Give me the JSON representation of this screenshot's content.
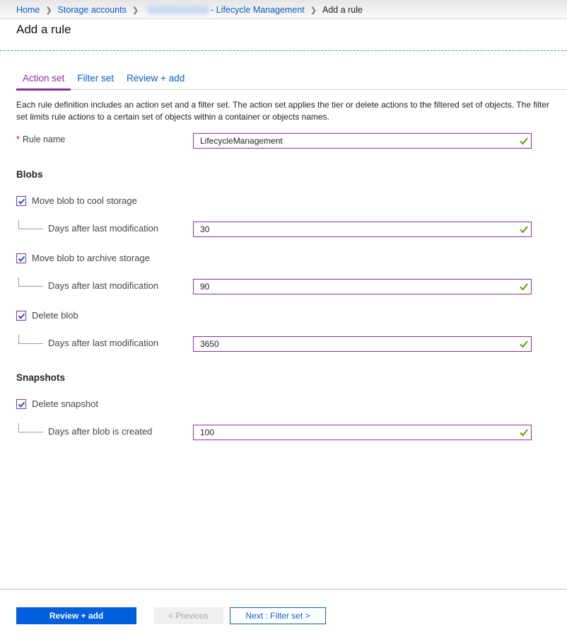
{
  "breadcrumb": {
    "items": [
      {
        "label": "Home"
      },
      {
        "label": "Storage accounts"
      },
      {
        "label": "- Lifecycle Management"
      },
      {
        "label": "Add a rule"
      }
    ]
  },
  "page": {
    "title": "Add a rule"
  },
  "tabs": [
    {
      "label": "Action set",
      "active": true
    },
    {
      "label": "Filter set",
      "active": false
    },
    {
      "label": "Review + add",
      "active": false
    }
  ],
  "description": "Each rule definition includes an action set and a filter set. The action set applies the tier or delete actions to the filtered set of objects. The filter set limits rule actions to a certain set of objects within a container or objects names.",
  "rule_name": {
    "required_marker": "*",
    "label": "Rule name",
    "value": "LifecycleManagement"
  },
  "blobs": {
    "heading": "Blobs",
    "actions": [
      {
        "label": "Move blob to cool storage",
        "checked": true,
        "sub_label": "Days after last modification",
        "value": "30"
      },
      {
        "label": "Move blob to archive storage",
        "checked": true,
        "sub_label": "Days after last modification",
        "value": "90"
      },
      {
        "label": "Delete blob",
        "checked": true,
        "sub_label": "Days after last modification",
        "value": "3650"
      }
    ]
  },
  "snapshots": {
    "heading": "Snapshots",
    "actions": [
      {
        "label": "Delete snapshot",
        "checked": true,
        "sub_label": "Days after blob is created",
        "value": "100"
      }
    ]
  },
  "footer": {
    "review_add_label": "Review + add",
    "previous_label": "< Previous",
    "next_label": "Next : Filter set >"
  },
  "colors": {
    "accent": "#8a2fa3",
    "link": "#0b5cc8",
    "primary_button": "#005fdc",
    "valid_check": "#57a300"
  }
}
